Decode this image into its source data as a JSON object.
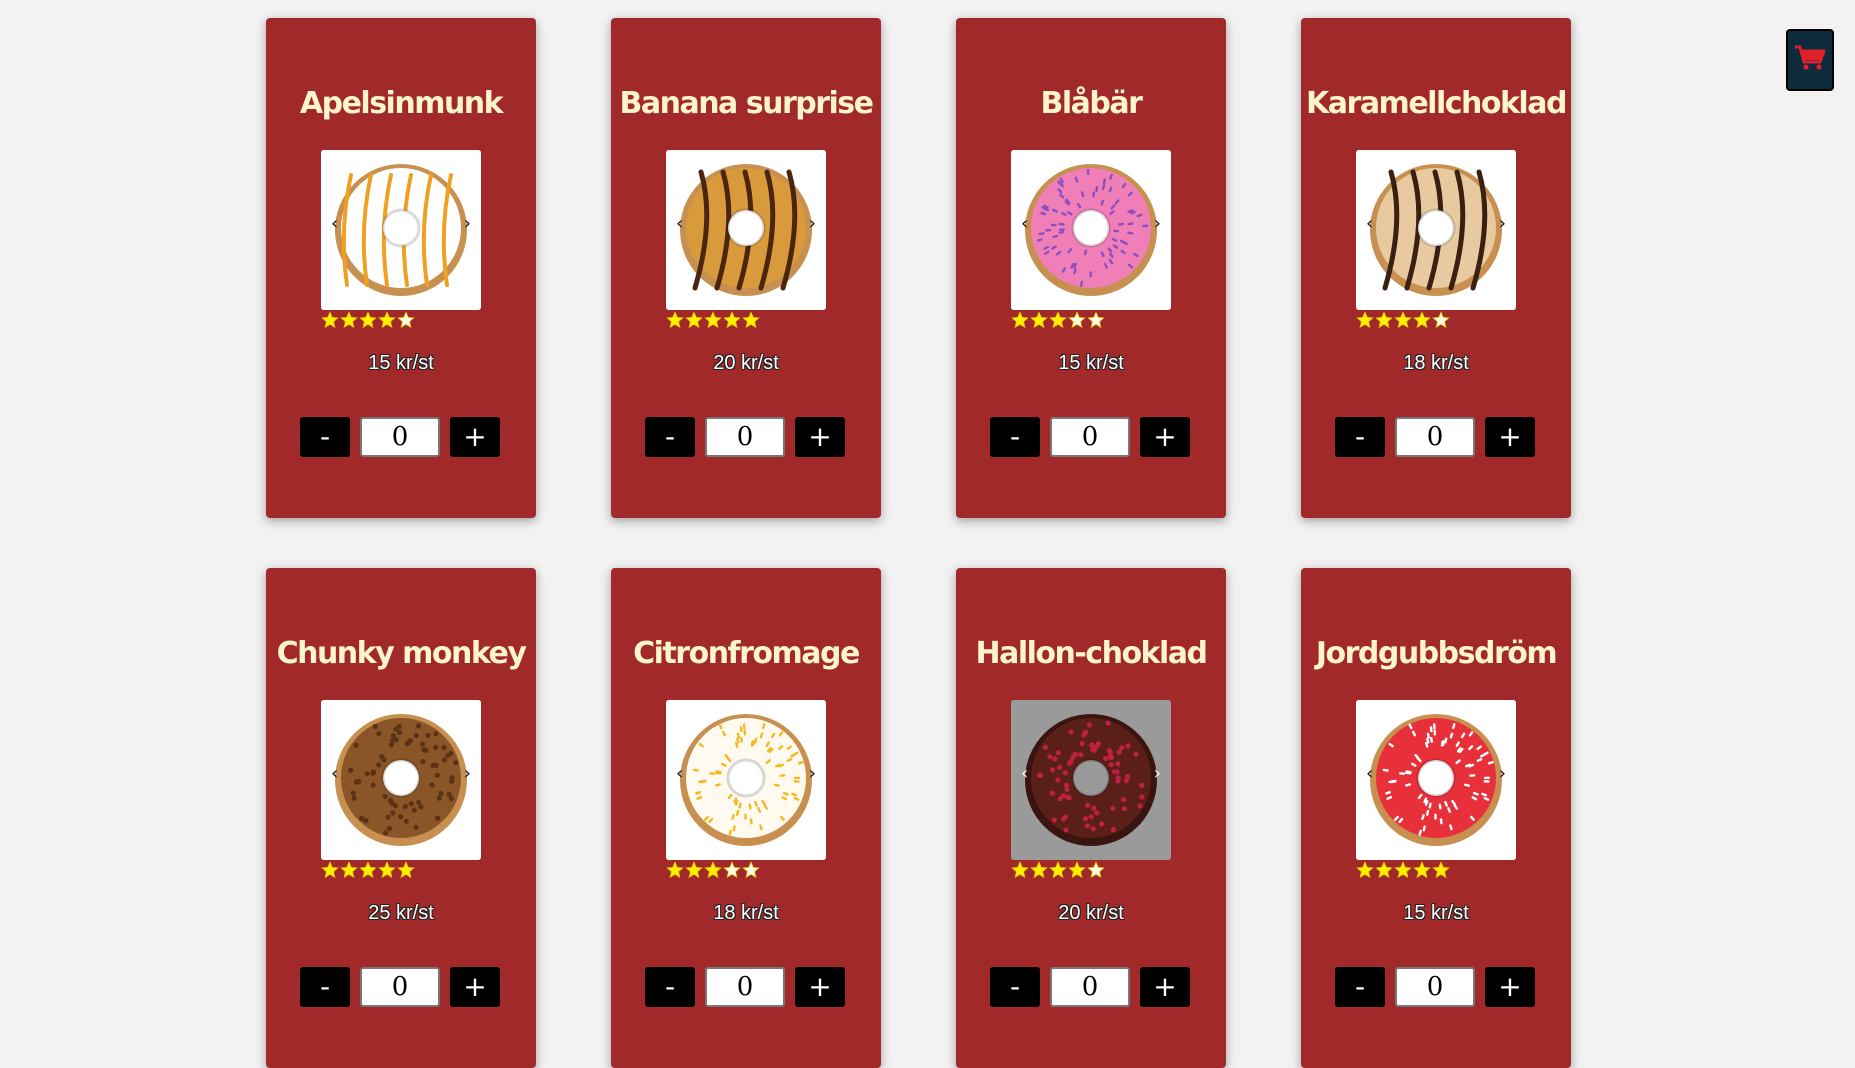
{
  "cart": {
    "icon": "shopping-cart-icon",
    "icon_color": "#e0202a",
    "background": "#0d2b3a"
  },
  "card_background": "#a1292a",
  "title_color": "#fff5cc",
  "star_color": "#ffee00",
  "products": [
    {
      "name": "Apelsinmunk",
      "price": "15 kr/st",
      "rating": 4,
      "quantity": "0",
      "minus_label": "-",
      "plus_label": "+",
      "prev_label": "‹",
      "next_label": "›",
      "image": "white donut with orange stripes",
      "icing": "#ffffff",
      "topping": "#f0a020",
      "style": "stripes",
      "bg": "light"
    },
    {
      "name": "Banana surprise",
      "price": "20 kr/st",
      "rating": 5,
      "quantity": "0",
      "minus_label": "-",
      "plus_label": "+",
      "prev_label": "‹",
      "next_label": "›",
      "image": "caramel donut with chocolate drizzle",
      "icing": "#d89a3a",
      "topping": "#4a2510",
      "style": "drizzle",
      "bg": "light"
    },
    {
      "name": "Blåbär",
      "price": "15 kr/st",
      "rating": 3,
      "quantity": "0",
      "minus_label": "-",
      "plus_label": "+",
      "prev_label": "‹",
      "next_label": "›",
      "image": "pink donut with purple sprinkles",
      "icing": "#f07fb8",
      "topping": "#8a4fc0",
      "style": "sprinkles",
      "bg": "light"
    },
    {
      "name": "Karamellchoklad",
      "price": "18 kr/st",
      "rating": 4,
      "quantity": "0",
      "minus_label": "-",
      "plus_label": "+",
      "prev_label": "‹",
      "next_label": "›",
      "image": "caramel donut with chocolate stripes and nuts",
      "icing": "#e8c9a0",
      "topping": "#3a2010",
      "style": "drizzle",
      "bg": "light"
    },
    {
      "name": "Chunky monkey",
      "price": "25 kr/st",
      "rating": 5,
      "quantity": "0",
      "minus_label": "-",
      "plus_label": "+",
      "prev_label": "‹",
      "next_label": "›",
      "image": "chocolate donut with crumbles",
      "icing": "#8a5628",
      "topping": "#5a3215",
      "style": "crumbs",
      "bg": "light"
    },
    {
      "name": "Citronfromage",
      "price": "18 kr/st",
      "rating": 3,
      "quantity": "0",
      "minus_label": "-",
      "plus_label": "+",
      "prev_label": "‹",
      "next_label": "›",
      "image": "white donut with yellow sprinkles",
      "icing": "#fffaf0",
      "topping": "#f5b820",
      "style": "sprinkles",
      "bg": "light"
    },
    {
      "name": "Hallon-choklad",
      "price": "20 kr/st",
      "rating": 4,
      "quantity": "0",
      "minus_label": "-",
      "plus_label": "+",
      "prev_label": "‹",
      "next_label": "›",
      "image": "chocolate donut with raspberry pieces",
      "icing": "#5a2018",
      "topping": "#c02040",
      "style": "crumbs",
      "bg": "dark"
    },
    {
      "name": "Jordgubbsdröm",
      "price": "15 kr/st",
      "rating": 5,
      "quantity": "0",
      "minus_label": "-",
      "plus_label": "+",
      "prev_label": "‹",
      "next_label": "›",
      "image": "red donut with white sprinkles",
      "icing": "#e8303a",
      "topping": "#ffffff",
      "style": "sprinkles",
      "bg": "light"
    }
  ]
}
